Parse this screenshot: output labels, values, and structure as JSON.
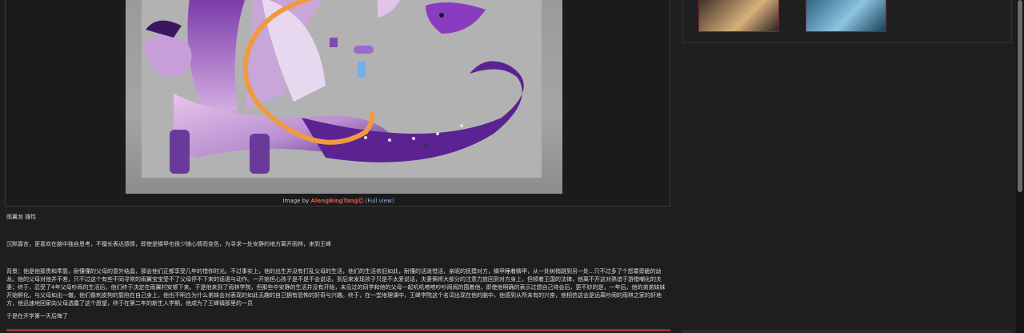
{
  "image": {
    "alt_label": "dragon reference sheet artwork",
    "caption_prefix": "Image by ",
    "artist": "AlengBingTang",
    "artist_badge": "Ⓒ",
    "full_view_link": "(Full view)"
  },
  "bio": {
    "title": "雨翼龙 雄性",
    "personality": "沉默寡言，更喜欢在脑中独自思考，不擅长表达感情，即使是鳞甲也很少随心情而变色，为寻求一处安静的地方离开雨林，来到王峰",
    "background": "背景：他是他那贵和乖靠，耐懂懂的父母的意外结晶，那会他们正都享受几年的惜你时光。不过事实上，他的出生并没有打乱父母的生活，他们的生活依旧如此，耐懂的活泼惜活，亲昵的抚摸对方，鳞甲睡着鳞甲，从一处树梢跳到另一处...只不过多了个怒罪旁脆的幼龙。他的父母对他并不差，只不过这个有些不同寻常的雨翼宝宝受不了父母停不下来的话语与动作。一开始担心孩子是不是不会说话，到后来发现孩子只是不太爱说话，夫妻俩将大部分的注意力放回到对方身上，但顺着王国的法律，他离不开这对熟谙于游猎嘲化的夫妻；终于，忍受了4年父母吵闹的生活后，他们终于决定在雨翼村安顿下来。于是他来到了雨林学院，但那些中安静的生活并没有开始，未见过的同学和他的父母一起叽叽喳喳吵吵闹闹的围着他，即使他明确的表示过想自己待会后，更不妙的是，一年后，他的弟弟妹妹开始孵化，与父母如出一辙，他们像刺皮狗的靠陷在自己身上，他也不明白为什么弟妹会对表现的如此无趣的自己拥有恐怖的好奇与兴趣。终于，在一堂地理课中，王峰学院这个名词出现在他的脑中，他感到从所未有的兴奋，他相信这会是远离吵闹的雨林之家的好地方，他迅速地回家向父母透露了这个愿望，终于在第二年的新生入学期，他成为了王峰镇那里的一员",
    "regret": "于是在开学第一天后悔了"
  },
  "sidebar": {
    "thumbnails": [
      {
        "label": "cream dragon thumbnail"
      },
      {
        "label": "blue dragon thumbnail"
      }
    ]
  },
  "colors": {
    "artist_link": "#e0564b",
    "full_view_link": "#8fb7e8",
    "accent_bar": "#9b2e2e"
  }
}
